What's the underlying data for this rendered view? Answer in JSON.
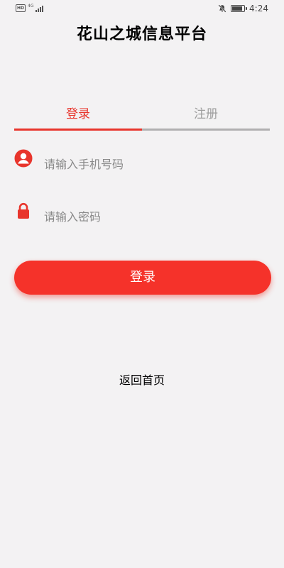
{
  "status_bar": {
    "hd_badge": "HD",
    "network": "4G",
    "signal_bars": 4,
    "mute_icon": "bell-off-icon",
    "battery_level": 0.9,
    "time": "4:24"
  },
  "app": {
    "title": "花山之城信息平台"
  },
  "tabs": [
    {
      "label": "登录",
      "active": true
    },
    {
      "label": "注册",
      "active": false
    }
  ],
  "form": {
    "phone": {
      "icon": "user-icon",
      "placeholder": "请输入手机号码",
      "value": ""
    },
    "password": {
      "icon": "lock-icon",
      "placeholder": "请输入密码",
      "value": ""
    },
    "submit_label": "登录"
  },
  "back_home_label": "返回首页",
  "colors": {
    "accent": "#e8352c",
    "button": "#f5322a",
    "tab_inactive_text": "#9e9e9e",
    "tab_inactive_bar": "#b0afb0",
    "background": "#f3f2f3"
  }
}
